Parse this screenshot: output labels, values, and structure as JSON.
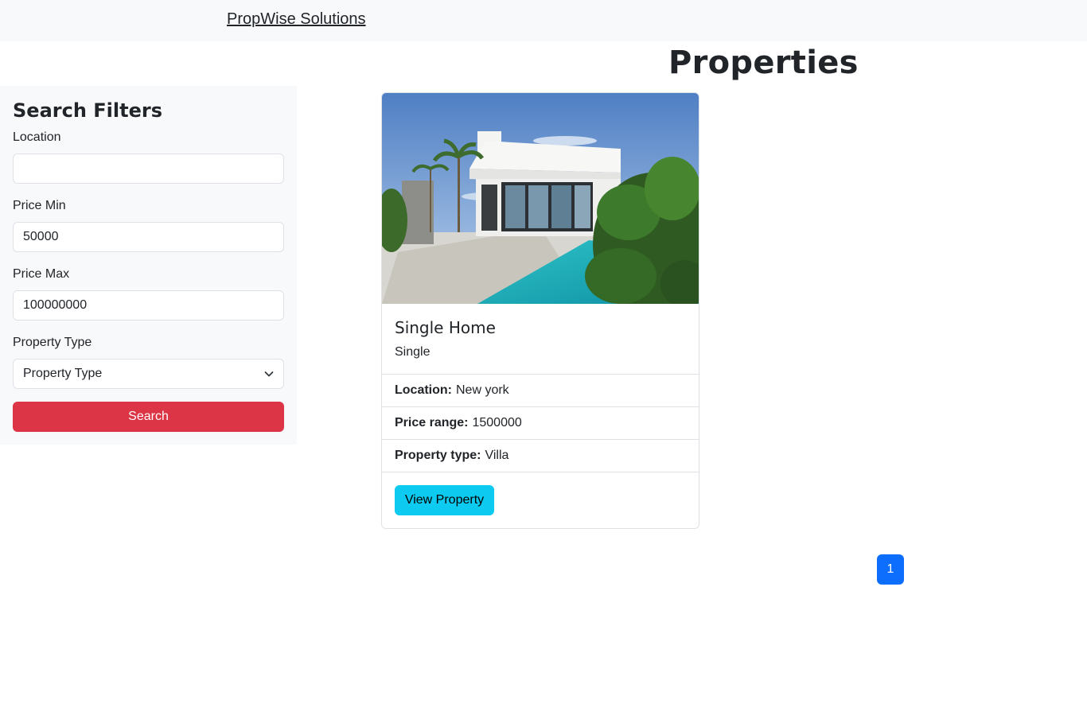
{
  "nav": {
    "brand": "PropWise Solutions"
  },
  "page": {
    "title": "Properties"
  },
  "filters": {
    "heading": "Search Filters",
    "location": {
      "label": "Location",
      "value": "",
      "placeholder": ""
    },
    "price_min": {
      "label": "Price Min",
      "value": "50000"
    },
    "price_max": {
      "label": "Price Max",
      "value": "100000000"
    },
    "property_type": {
      "label": "Property Type",
      "selected": "Property Type"
    },
    "search_label": "Search",
    "search_color": "#dc3545"
  },
  "property": {
    "title": "Single Home",
    "subtitle": "Single",
    "location_label": "Location:",
    "location_value": "New york",
    "price_label": "Price range:",
    "price_value": "1500000",
    "type_label": "Property type:",
    "type_value": "Villa",
    "view_label": "View Property",
    "view_color": "#0dcaf0"
  },
  "pagination": {
    "current": "1",
    "color": "#0d6efd"
  }
}
